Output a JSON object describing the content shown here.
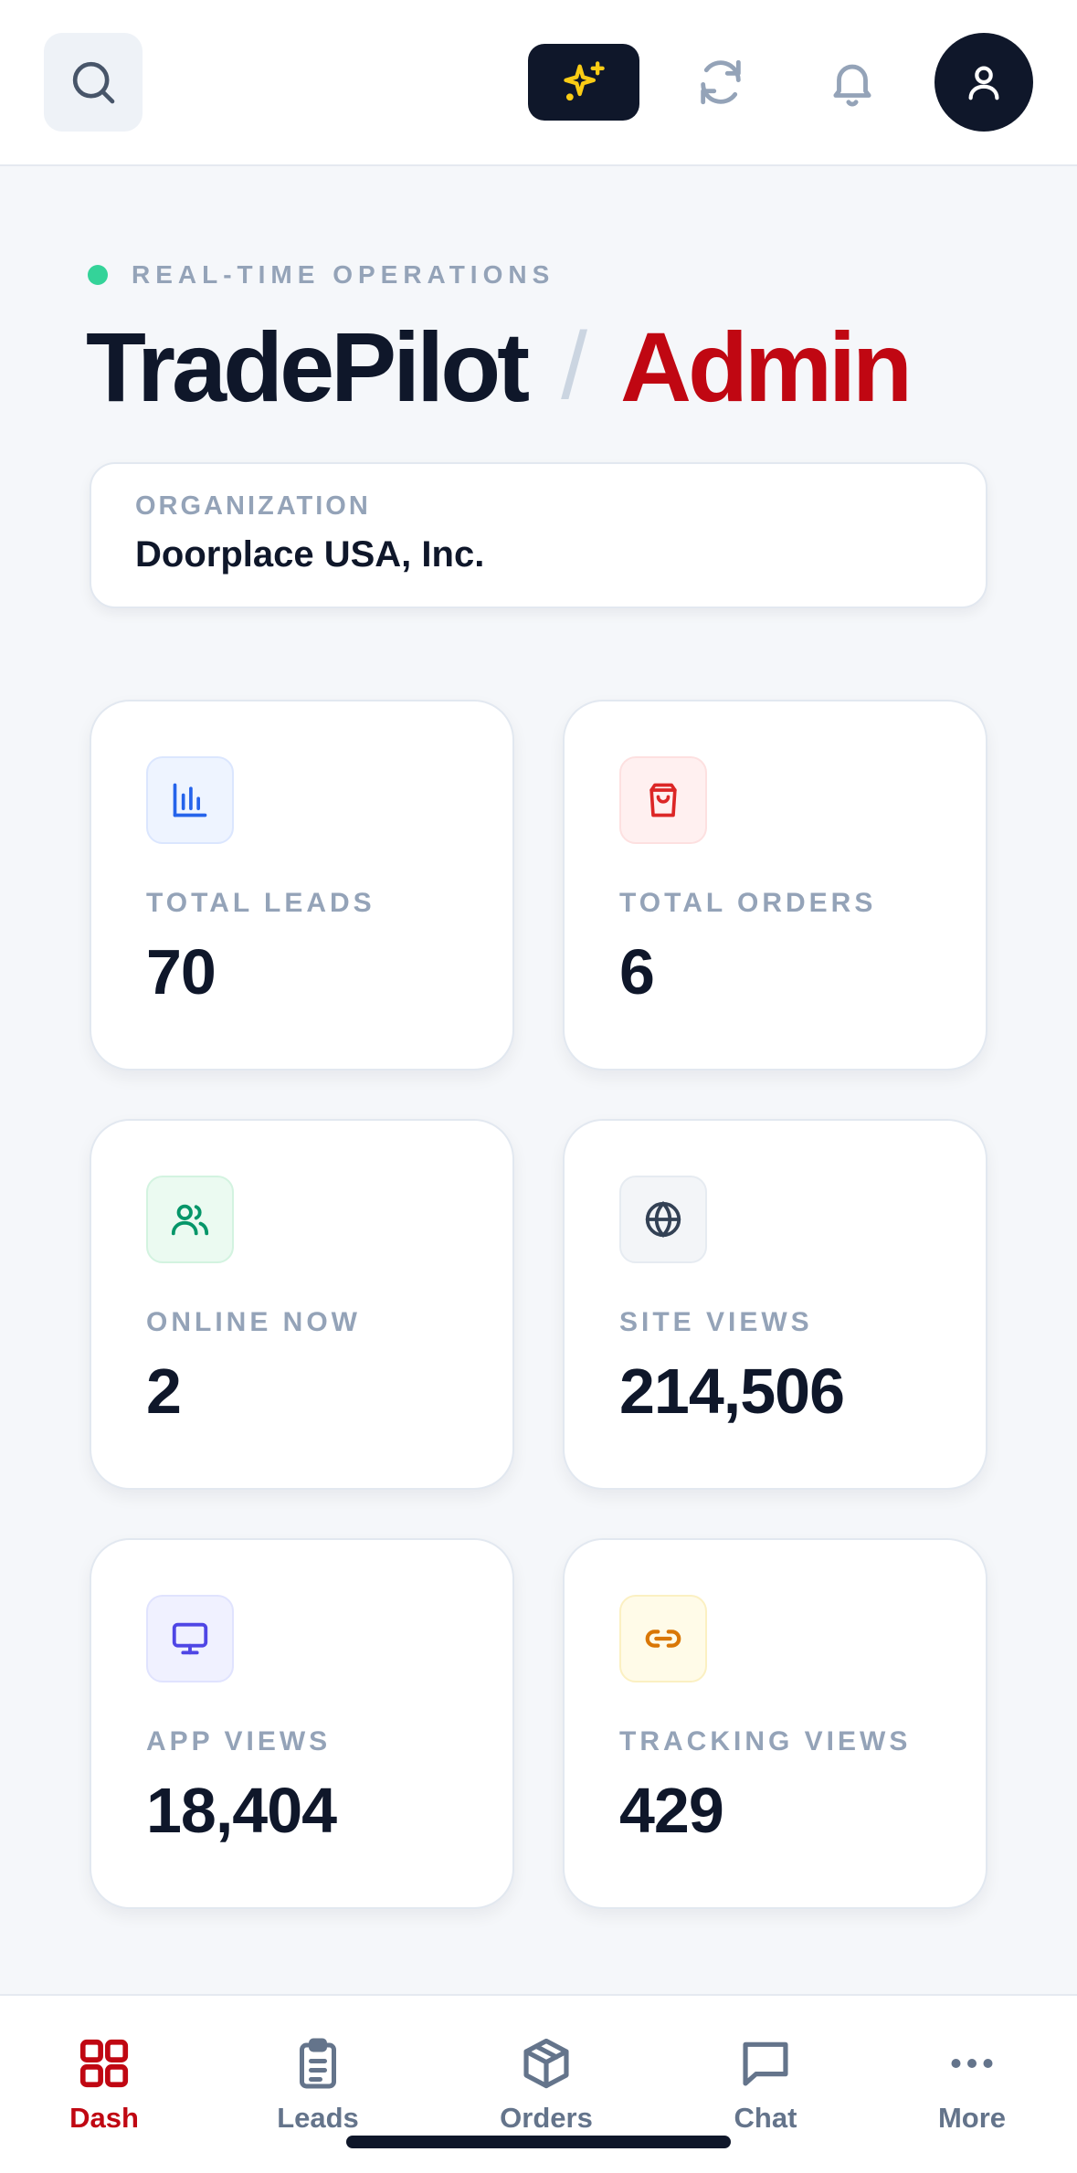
{
  "header": {
    "live_label": "REAL-TIME OPERATIONS",
    "title_main": "TradePilot",
    "title_separator": "/",
    "title_accent": "Admin"
  },
  "organization": {
    "label": "ORGANIZATION",
    "value": "Doorplace USA, Inc."
  },
  "stats": [
    {
      "label": "TOTAL LEADS",
      "value": "70",
      "icon": "bar-chart-icon",
      "color": "#2563eb"
    },
    {
      "label": "TOTAL ORDERS",
      "value": "6",
      "icon": "shopping-bag-icon",
      "color": "#dc2626"
    },
    {
      "label": "ONLINE NOW",
      "value": "2",
      "icon": "users-icon",
      "color": "#059669"
    },
    {
      "label": "SITE VIEWS",
      "value": "214,506",
      "icon": "globe-icon",
      "color": "#334155"
    },
    {
      "label": "APP VIEWS",
      "value": "18,404",
      "icon": "monitor-icon",
      "color": "#4f46e5"
    },
    {
      "label": "TRACKING VIEWS",
      "value": "429",
      "icon": "link-icon",
      "color": "#d97706"
    }
  ],
  "nav": [
    {
      "label": "Dash",
      "icon": "grid-icon",
      "active": true
    },
    {
      "label": "Leads",
      "icon": "clipboard-icon",
      "active": false
    },
    {
      "label": "Orders",
      "icon": "package-icon",
      "active": false
    },
    {
      "label": "Chat",
      "icon": "chat-icon",
      "active": false
    },
    {
      "label": "More",
      "icon": "more-icon",
      "active": false
    }
  ],
  "colors": {
    "accent": "#c00712",
    "dark": "#0f172a",
    "live": "#34d399",
    "sparkle": "#facc15"
  }
}
